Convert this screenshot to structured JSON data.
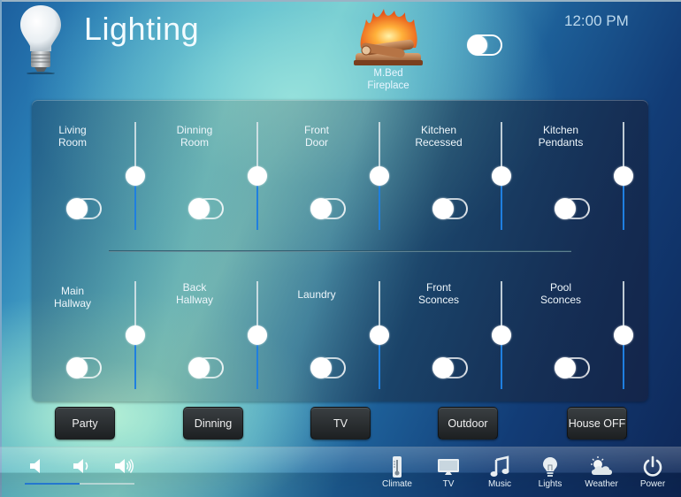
{
  "header": {
    "title": "Lighting",
    "clock": "12:00 PM",
    "fireplace": {
      "label_line1": "M.Bed",
      "label_line2": "Fireplace",
      "toggle_on": false
    }
  },
  "lights": [
    {
      "name_line1": "Living",
      "name_line2": "Room",
      "on": false,
      "level": 0.5
    },
    {
      "name_line1": "Dinning",
      "name_line2": "Room",
      "on": false,
      "level": 0.5
    },
    {
      "name_line1": "Front",
      "name_line2": "Door",
      "on": false,
      "level": 0.5
    },
    {
      "name_line1": "Kitchen",
      "name_line2": "Recessed",
      "on": false,
      "level": 0.5
    },
    {
      "name_line1": "Kitchen",
      "name_line2": "Pendants",
      "on": false,
      "level": 0.5
    },
    {
      "name_line1": "Main",
      "name_line2": "Hallway",
      "on": false,
      "level": 0.5
    },
    {
      "name_line1": "Back",
      "name_line2": "Hallway",
      "on": false,
      "level": 0.5
    },
    {
      "name_line1": "Laundry",
      "name_line2": "",
      "on": false,
      "level": 0.5
    },
    {
      "name_line1": "Front",
      "name_line2": "Sconces",
      "on": false,
      "level": 0.5
    },
    {
      "name_line1": "Pool",
      "name_line2": "Sconces",
      "on": false,
      "level": 0.5
    }
  ],
  "scenes": [
    {
      "label": "Party"
    },
    {
      "label": "Dinning"
    },
    {
      "label": "TV"
    },
    {
      "label": "Outdoor"
    },
    {
      "label": "House OFF"
    }
  ],
  "volume": {
    "icons": [
      "volume-mute-icon",
      "volume-low-icon",
      "volume-high-icon"
    ],
    "level": 0.5
  },
  "nav": [
    {
      "label": "Climate",
      "icon": "thermometer-icon"
    },
    {
      "label": "TV",
      "icon": "tv-icon"
    },
    {
      "label": "Music",
      "icon": "music-note-icon"
    },
    {
      "label": "Lights",
      "icon": "lightbulb-icon"
    },
    {
      "label": "Weather",
      "icon": "weather-icon"
    },
    {
      "label": "Power",
      "icon": "power-icon"
    }
  ],
  "colors": {
    "slider_fill": "#1f7fe0",
    "volume_fill": "#2477cf",
    "button_bg": "#2a2e30"
  }
}
